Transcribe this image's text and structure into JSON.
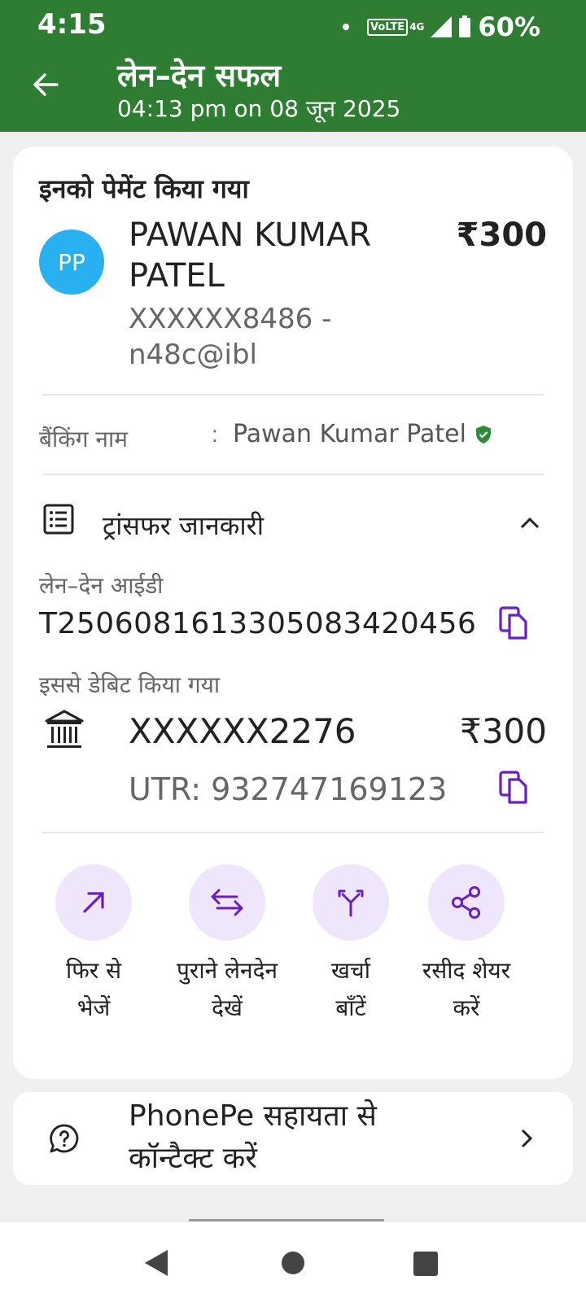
{
  "status_bar": {
    "time": "4:15",
    "volte": "VoLTE",
    "network": "4G",
    "battery": "60%"
  },
  "header": {
    "title": "लेन–देन सफल",
    "subtitle": "04:13 pm on 08 जून 2025"
  },
  "payee": {
    "section_label": "इनको पेमेंट किया गया",
    "avatar_initials": "PP",
    "name": "PAWAN KUMAR PATEL",
    "amount": "₹300",
    "upi_id": "XXXXXX8486 -n48c@ibl"
  },
  "banking": {
    "label": "बैंकिंग नाम",
    "colon": ":",
    "name": "Pawan Kumar Patel"
  },
  "transfer": {
    "title": "ट्रांसफर जानकारी",
    "txn_id_label": "लेन–देन आईडी",
    "txn_id": "T2506081613305083420456",
    "debited_label": "इससे डेबिट किया गया",
    "account": "XXXXXX2276",
    "amount": "₹300",
    "utr": "UTR: 932747169123"
  },
  "actions": [
    {
      "label": "फिर से\nभेजें",
      "icon": "arrow-up-right-icon"
    },
    {
      "label": "पुराने लेनदेन\nदेखें",
      "icon": "swap-arrows-icon"
    },
    {
      "label": "खर्चा\nबाँटें",
      "icon": "split-icon"
    },
    {
      "label": "रसीद शेयर\nकरें",
      "icon": "share-icon"
    }
  ],
  "help": {
    "text": "PhonePe सहायता से कॉन्टैक्ट करें"
  },
  "colors": {
    "header_green": "#2f7d32",
    "accent_purple": "#6a1fc2",
    "avatar_blue": "#29b0f0"
  }
}
